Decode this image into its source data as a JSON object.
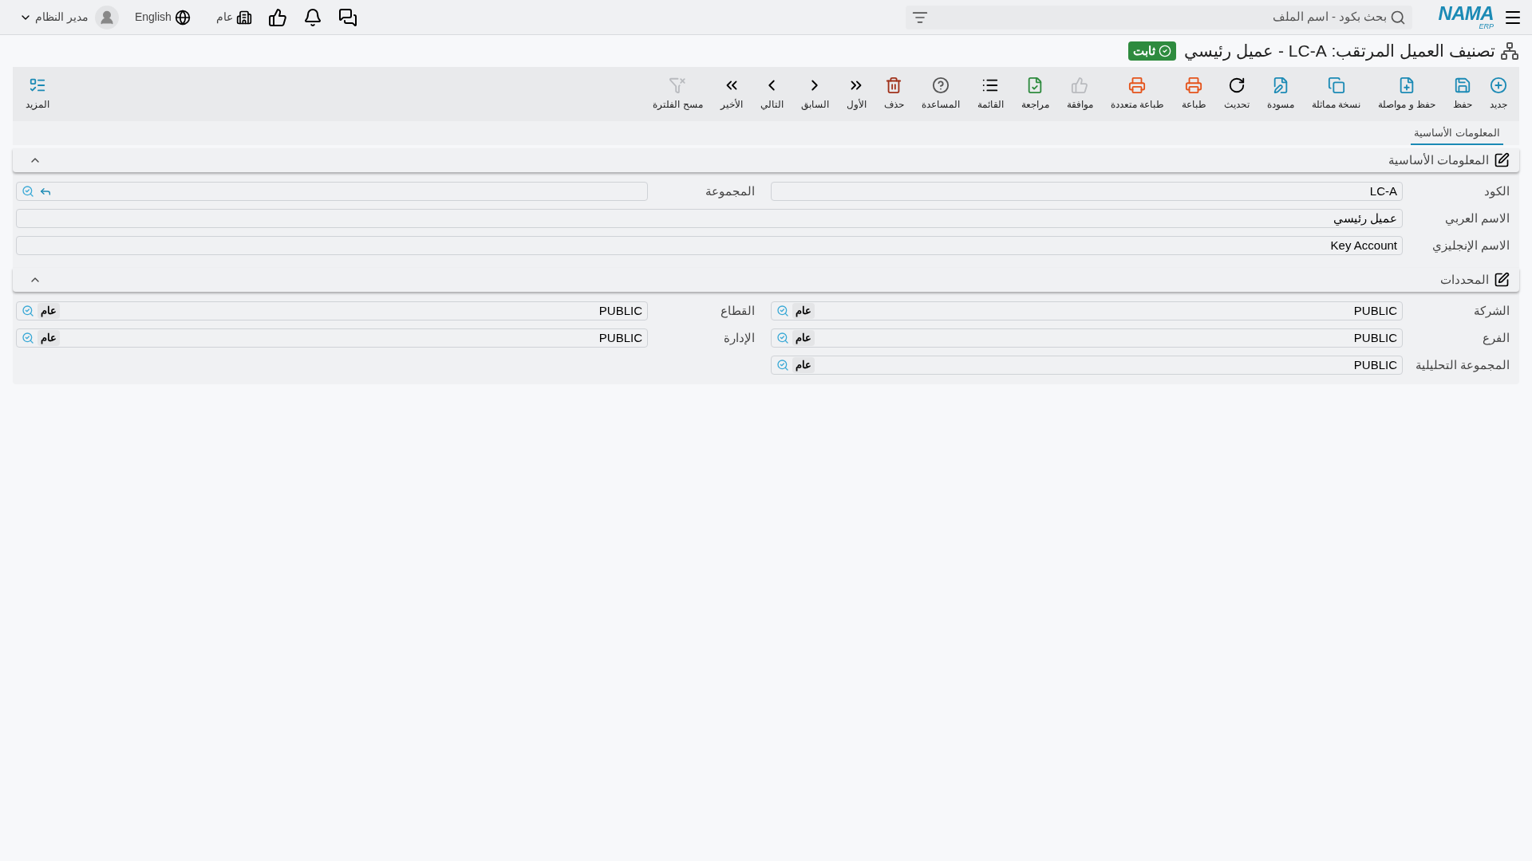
{
  "topbar": {
    "logo": "NAMA",
    "logo_sub": "ERP",
    "search": {
      "placeholder": "بحث بكود - اسم الملف"
    },
    "company": "عام",
    "language": "English",
    "user": "مدير النظام"
  },
  "title": "تصنيف العميل المرتقب: LC-A - عميل رئيسي",
  "status": "ثابت",
  "toolbar": [
    {
      "label": "جديد",
      "disabled": false
    },
    {
      "label": "حفظ",
      "disabled": false
    },
    {
      "label": "حفظ و مواصلة",
      "disabled": false
    },
    {
      "label": "نسخة مماثلة",
      "disabled": false
    },
    {
      "label": "مسودة",
      "disabled": false
    },
    {
      "label": "تحديث",
      "disabled": false
    },
    {
      "label": "طباعة",
      "disabled": false
    },
    {
      "label": "طباعة متعددة",
      "disabled": false
    },
    {
      "label": "موافقة",
      "disabled": true
    },
    {
      "label": "مراجعة",
      "disabled": false
    },
    {
      "label": "القائمة",
      "disabled": false
    },
    {
      "label": "المساعدة",
      "disabled": false
    },
    {
      "label": "حذف",
      "disabled": false
    },
    {
      "label": "الأول",
      "disabled": false
    },
    {
      "label": "السابق",
      "disabled": false
    },
    {
      "label": "التالي",
      "disabled": false
    },
    {
      "label": "الأخير",
      "disabled": false
    },
    {
      "label": "مسح الفلترة",
      "disabled": true
    }
  ],
  "more": "المزيد",
  "tabs": [
    {
      "label": "المعلومات الأساسية",
      "selected": true
    }
  ],
  "sections": [
    {
      "title": "المعلومات الأساسية",
      "expanded": true,
      "fields": [
        {
          "label": "الكود",
          "value": "LC-A",
          "kind": "text"
        },
        {
          "label": "المجموعة",
          "kind": "link_lookup"
        },
        {
          "label": "الاسم العربي",
          "value": "عميل رئيسي",
          "kind": "wide_text"
        },
        {
          "label": "الاسم الإنجليزي",
          "value": "Key Account",
          "kind": "wide_text"
        }
      ]
    },
    {
      "title": "المحددات",
      "expanded": true,
      "fields": [
        {
          "label": "الشركة",
          "value": "PUBLIC",
          "tag": "عام",
          "kind": "lookup"
        },
        {
          "label": "القطاع",
          "value": "PUBLIC",
          "tag": "عام",
          "kind": "lookup"
        },
        {
          "label": "الفرع",
          "value": "PUBLIC",
          "tag": "عام",
          "kind": "lookup"
        },
        {
          "label": "الإدارة",
          "value": "PUBLIC",
          "tag": "عام",
          "kind": "lookup"
        },
        {
          "label": "المجموعة التحليلية",
          "value": "PUBLIC",
          "tag": "عام",
          "kind": "lookup"
        }
      ]
    }
  ]
}
